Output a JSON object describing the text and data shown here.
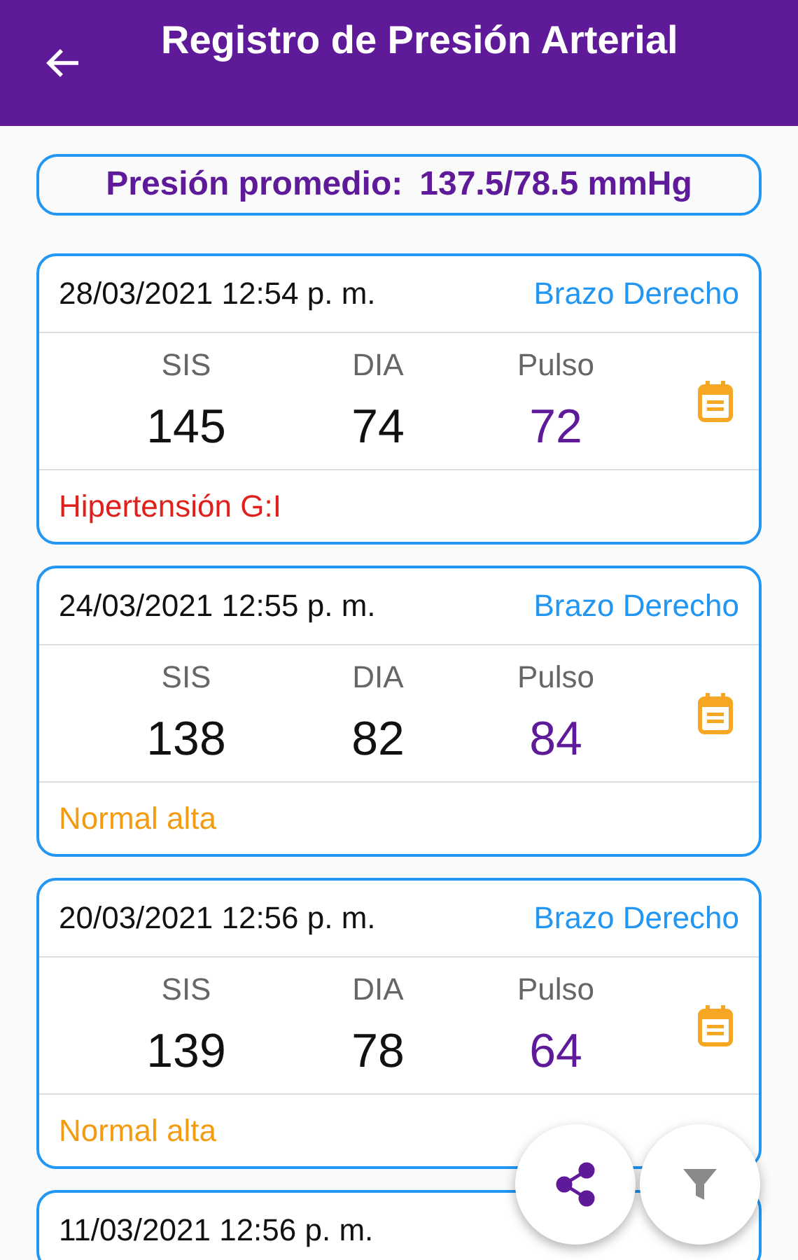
{
  "header": {
    "title": "Registro de Presión Arterial"
  },
  "average": {
    "label": "Presión promedio:",
    "value": "137.5/78.5 mmHg"
  },
  "readings": [
    {
      "date": "28/03/2021 12:54 p. m.",
      "arm": "Brazo Derecho",
      "values": [
        {
          "label": "SIS",
          "value": "145",
          "kind": "pressure"
        },
        {
          "label": "DIA",
          "value": "74",
          "kind": "pressure"
        },
        {
          "label": "Pulso",
          "value": "72",
          "kind": "pulse"
        }
      ],
      "status": {
        "text": "Hipertensión G:I",
        "color": "#e0201c"
      }
    },
    {
      "date": "24/03/2021 12:55 p. m.",
      "arm": "Brazo Derecho",
      "values": [
        {
          "label": "SIS",
          "value": "138",
          "kind": "pressure"
        },
        {
          "label": "DIA",
          "value": "82",
          "kind": "pressure"
        },
        {
          "label": "Pulso",
          "value": "84",
          "kind": "pulse"
        }
      ],
      "status": {
        "text": "Normal alta",
        "color": "#f39c12"
      }
    },
    {
      "date": "20/03/2021 12:56 p. m.",
      "arm": "Brazo Derecho",
      "values": [
        {
          "label": "SIS",
          "value": "139",
          "kind": "pressure"
        },
        {
          "label": "DIA",
          "value": "78",
          "kind": "pressure"
        },
        {
          "label": "Pulso",
          "value": "64",
          "kind": "pulse"
        }
      ],
      "status": {
        "text": "Normal alta",
        "color": "#f39c12"
      }
    },
    {
      "date": "11/03/2021 12:56 p. m."
    }
  ],
  "fabs": [
    {
      "kind": "share"
    },
    {
      "kind": "filter"
    }
  ]
}
